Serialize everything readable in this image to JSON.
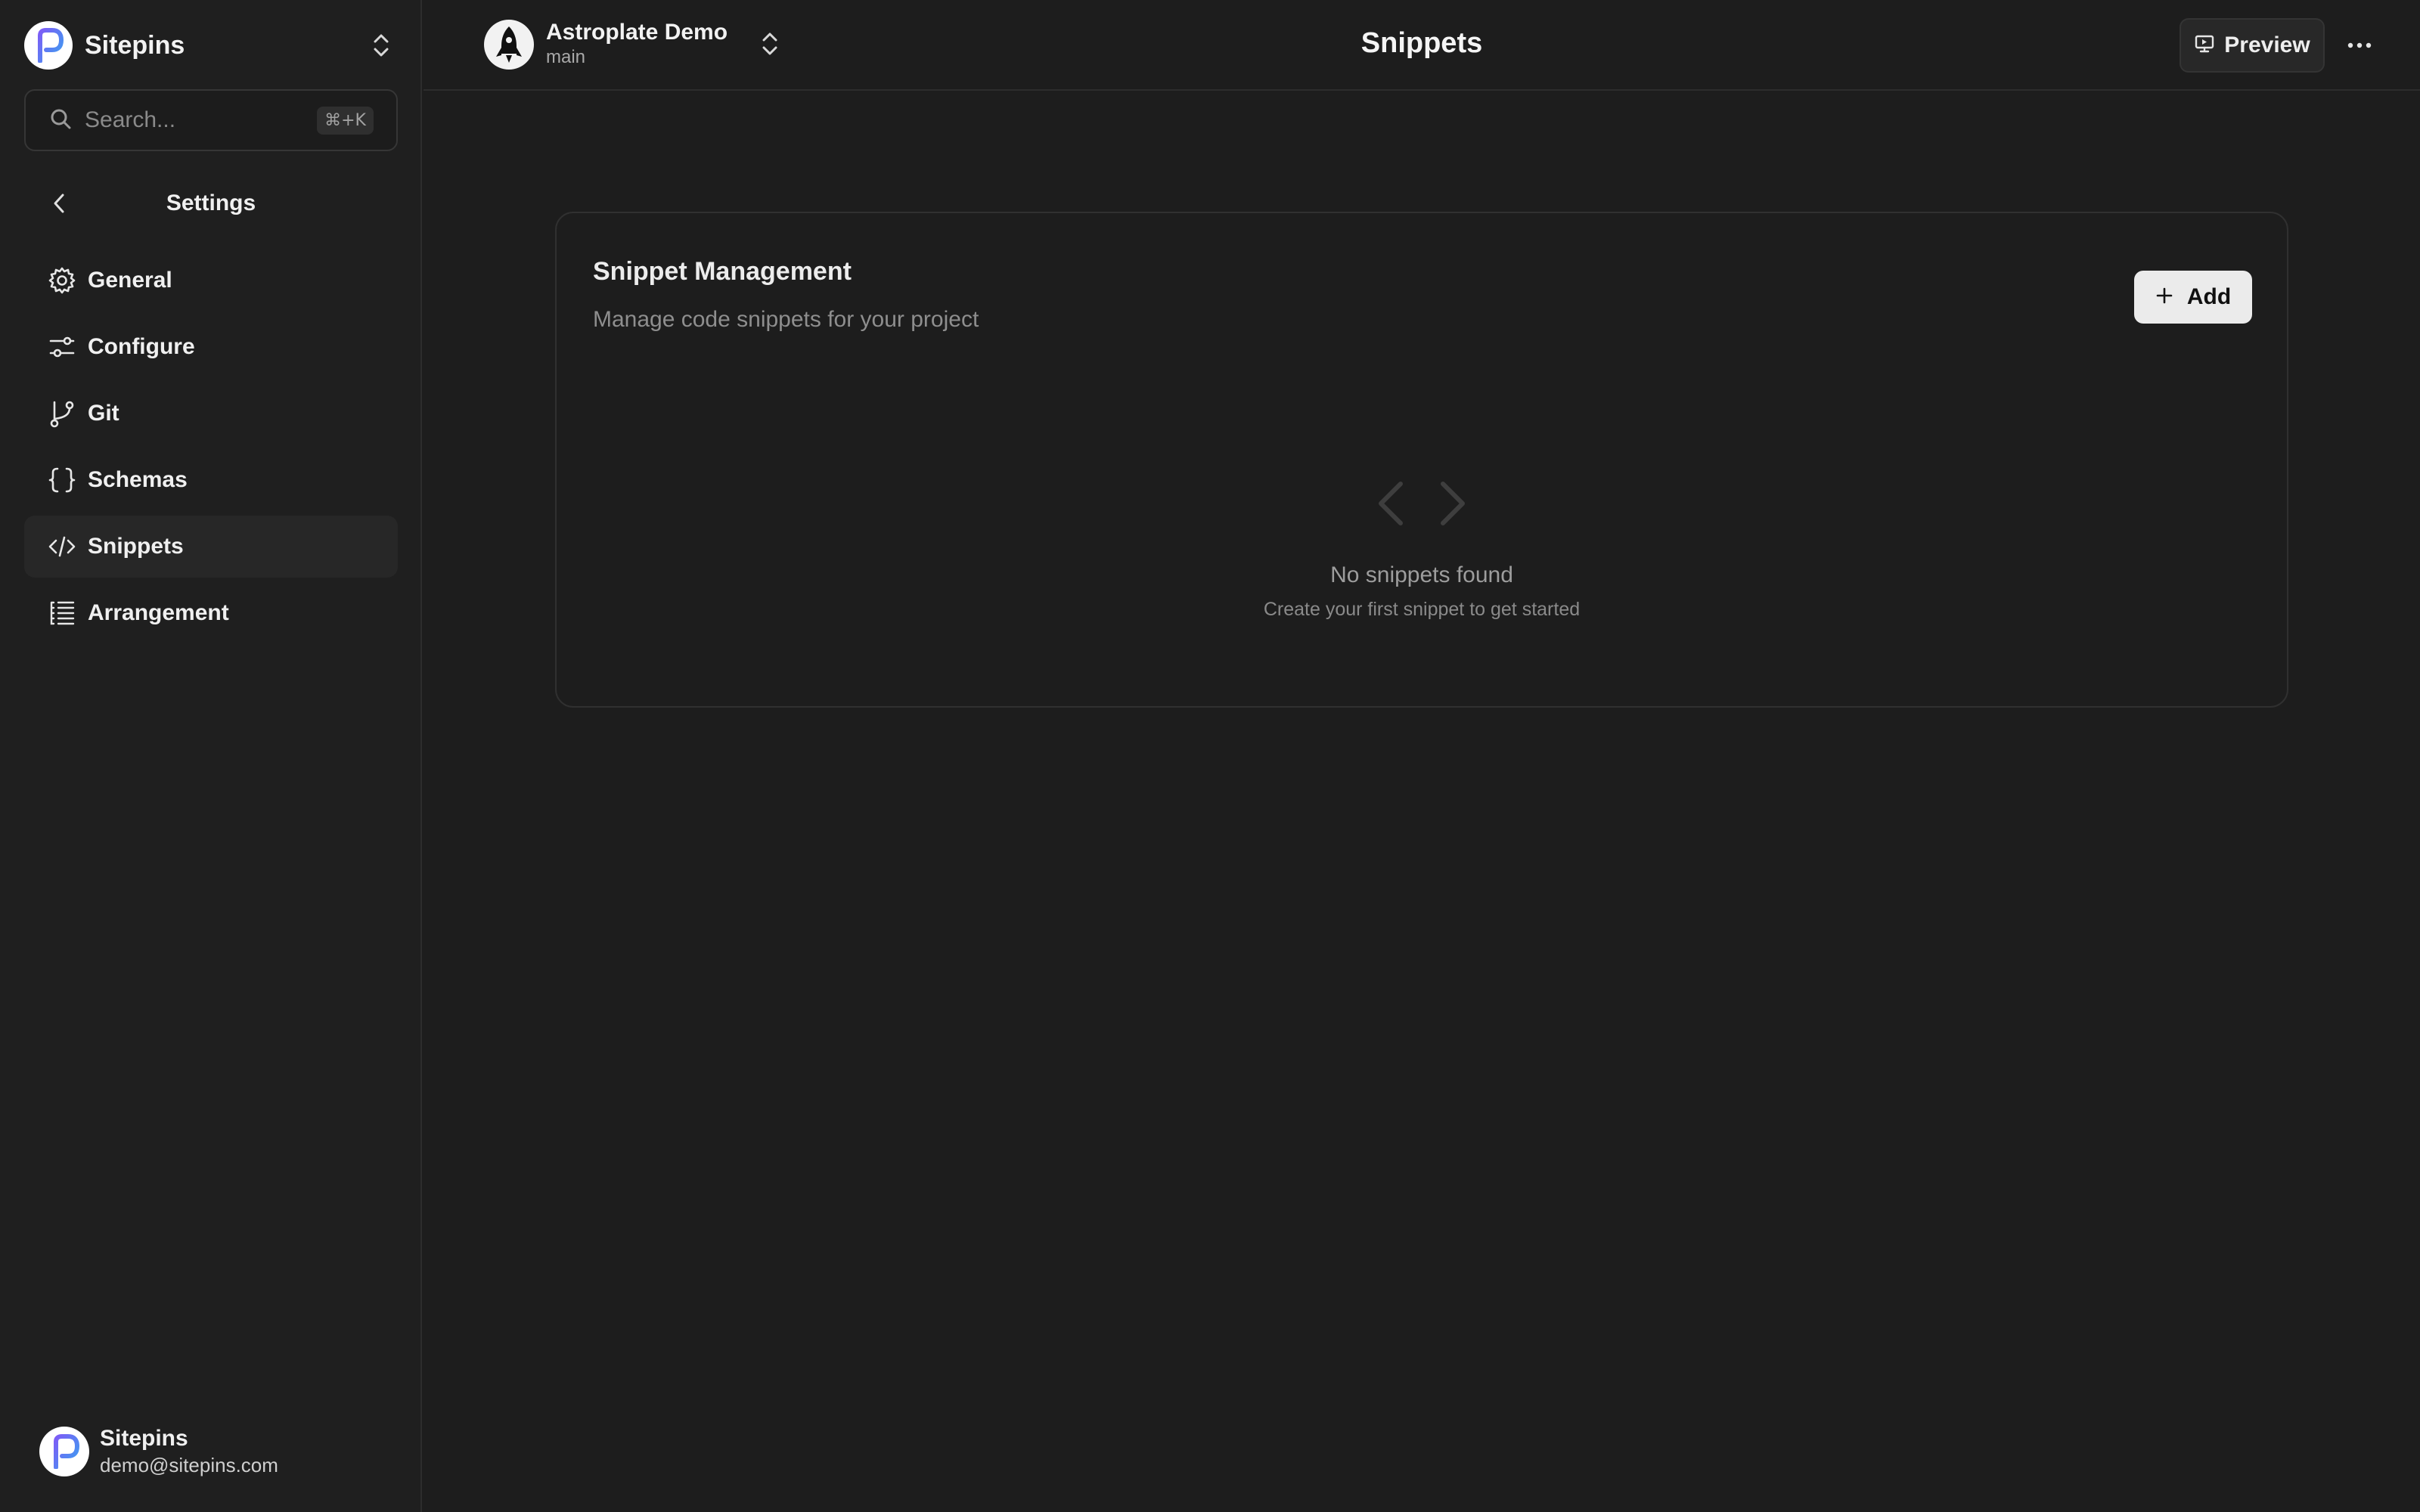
{
  "sidebar": {
    "brand": {
      "name": "Sitepins",
      "logo_icon": "sitepins-logo"
    },
    "search": {
      "placeholder": "Search...",
      "shortcut": "⌘+K"
    },
    "section_title": "Settings",
    "items": [
      {
        "label": "General",
        "icon": "gear-icon",
        "active": false
      },
      {
        "label": "Configure",
        "icon": "sliders-icon",
        "active": false
      },
      {
        "label": "Git",
        "icon": "git-branch-icon",
        "active": false
      },
      {
        "label": "Schemas",
        "icon": "braces-icon",
        "active": false
      },
      {
        "label": "Snippets",
        "icon": "code-icon",
        "active": true
      },
      {
        "label": "Arrangement",
        "icon": "list-tree-icon",
        "active": false
      }
    ],
    "user": {
      "name": "Sitepins",
      "email": "demo@sitepins.com"
    }
  },
  "header": {
    "project": {
      "name": "Astroplate Demo",
      "branch": "main"
    },
    "title": "Snippets",
    "preview_label": "Preview"
  },
  "main": {
    "card": {
      "title": "Snippet Management",
      "subtitle": "Manage code snippets for your project",
      "add_label": "Add",
      "empty_title": "No snippets found",
      "empty_subtitle": "Create your first snippet to get started"
    }
  },
  "colors": {
    "background": "#1d1d1d",
    "sidebar": "#1f1f1f",
    "active_item": "#272727",
    "add_button": "#ebebeb"
  }
}
